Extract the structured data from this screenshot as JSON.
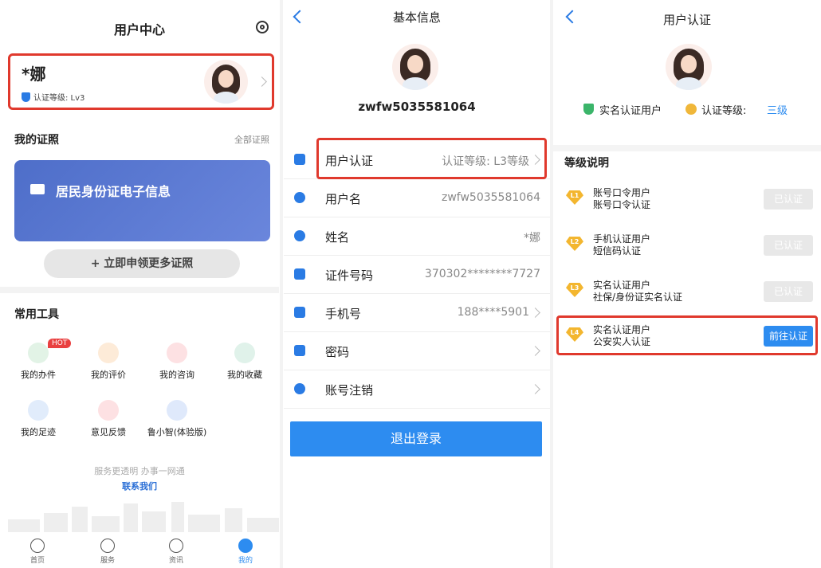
{
  "panel1": {
    "title": "用户中心",
    "user": {
      "name": "*娜",
      "cert_level": "认证等级: Lv3"
    },
    "certs": {
      "title": "我的证照",
      "all_link": "全部证照",
      "card_label": "居民身份证电子信息",
      "apply_button": "+ 立即申领更多证照"
    },
    "tools": {
      "title": "常用工具",
      "hot_badge": "HOT",
      "items": [
        {
          "label": "我的办件",
          "icon": "briefcase-icon"
        },
        {
          "label": "我的评价",
          "icon": "rating-icon"
        },
        {
          "label": "我的咨询",
          "icon": "chat-icon"
        },
        {
          "label": "我的收藏",
          "icon": "star-icon"
        },
        {
          "label": "我的足迹",
          "icon": "footprint-icon"
        },
        {
          "label": "意见反馈",
          "icon": "feedback-icon"
        },
        {
          "label": "鲁小智(体验版)",
          "icon": "robot-icon"
        }
      ]
    },
    "slogan": "服务更透明 办事一网通",
    "contact": "联系我们",
    "tabbar": [
      {
        "label": "首页"
      },
      {
        "label": "服务"
      },
      {
        "label": "资讯"
      },
      {
        "label": "我的"
      }
    ],
    "colors": {
      "accent": "#2d8cf0",
      "highlight": "#e0392d"
    }
  },
  "panel2": {
    "title": "基本信息",
    "username": "zwfw5035581064",
    "rows": [
      {
        "label": "用户认证",
        "value": "认证等级: L3等级"
      },
      {
        "label": "用户名",
        "value": "zwfw5035581064"
      },
      {
        "label": "姓名",
        "value": "*娜"
      },
      {
        "label": "证件号码",
        "value": "370302********7727"
      },
      {
        "label": "手机号",
        "value": "188****5901"
      },
      {
        "label": "密码",
        "value": ""
      },
      {
        "label": "账号注销",
        "value": ""
      }
    ],
    "logout": "退出登录"
  },
  "panel3": {
    "title": "用户认证",
    "realname": "实名认证用户",
    "level_label": "认证等级:",
    "level_value": "三级",
    "section_title": "等级说明",
    "levels": [
      {
        "badge": "L1",
        "line1": "账号口令用户",
        "line2": "账号口令认证",
        "button": "已认证"
      },
      {
        "badge": "L2",
        "line1": "手机认证用户",
        "line2": "短信码认证",
        "button": "已认证"
      },
      {
        "badge": "L3",
        "line1": "实名认证用户",
        "line2": "社保/身份证实名认证",
        "button": "已认证"
      },
      {
        "badge": "L4",
        "line1": "实名认证用户",
        "line2": "公安实人认证",
        "button": "前往认证"
      }
    ]
  }
}
